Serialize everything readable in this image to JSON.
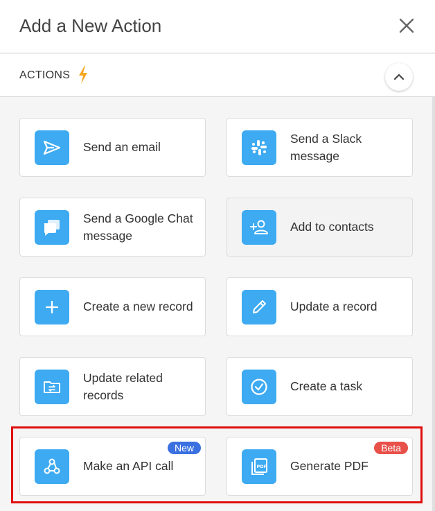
{
  "header": {
    "title": "Add a New Action",
    "close_icon": "close-icon"
  },
  "section": {
    "label": "ACTIONS",
    "bolt_icon": "lightning-bolt-icon",
    "collapse_icon": "chevron-up-icon",
    "accent": "#f5a623"
  },
  "colors": {
    "icon_bg": "#3daaf2",
    "badge_new": "#3a70e0",
    "badge_beta": "#e8504a",
    "highlight": "#e00d0d"
  },
  "actions": [
    {
      "label": "Send an email",
      "icon": "send-icon"
    },
    {
      "label": "Send a Slack message",
      "icon": "slack-icon"
    },
    {
      "label": "Send a Google Chat message",
      "icon": "chat-icon"
    },
    {
      "label": "Add to contacts",
      "icon": "add-contact-icon"
    },
    {
      "label": "Create a new record",
      "icon": "plus-icon"
    },
    {
      "label": "Update a record",
      "icon": "pencil-icon"
    },
    {
      "label": "Update related records",
      "icon": "folder-sync-icon"
    },
    {
      "label": "Create a task",
      "icon": "check-circle-icon"
    },
    {
      "label": "Make an API call",
      "icon": "webhook-icon",
      "badge": "New"
    },
    {
      "label": "Generate PDF",
      "icon": "pdf-icon",
      "badge": "Beta"
    }
  ]
}
